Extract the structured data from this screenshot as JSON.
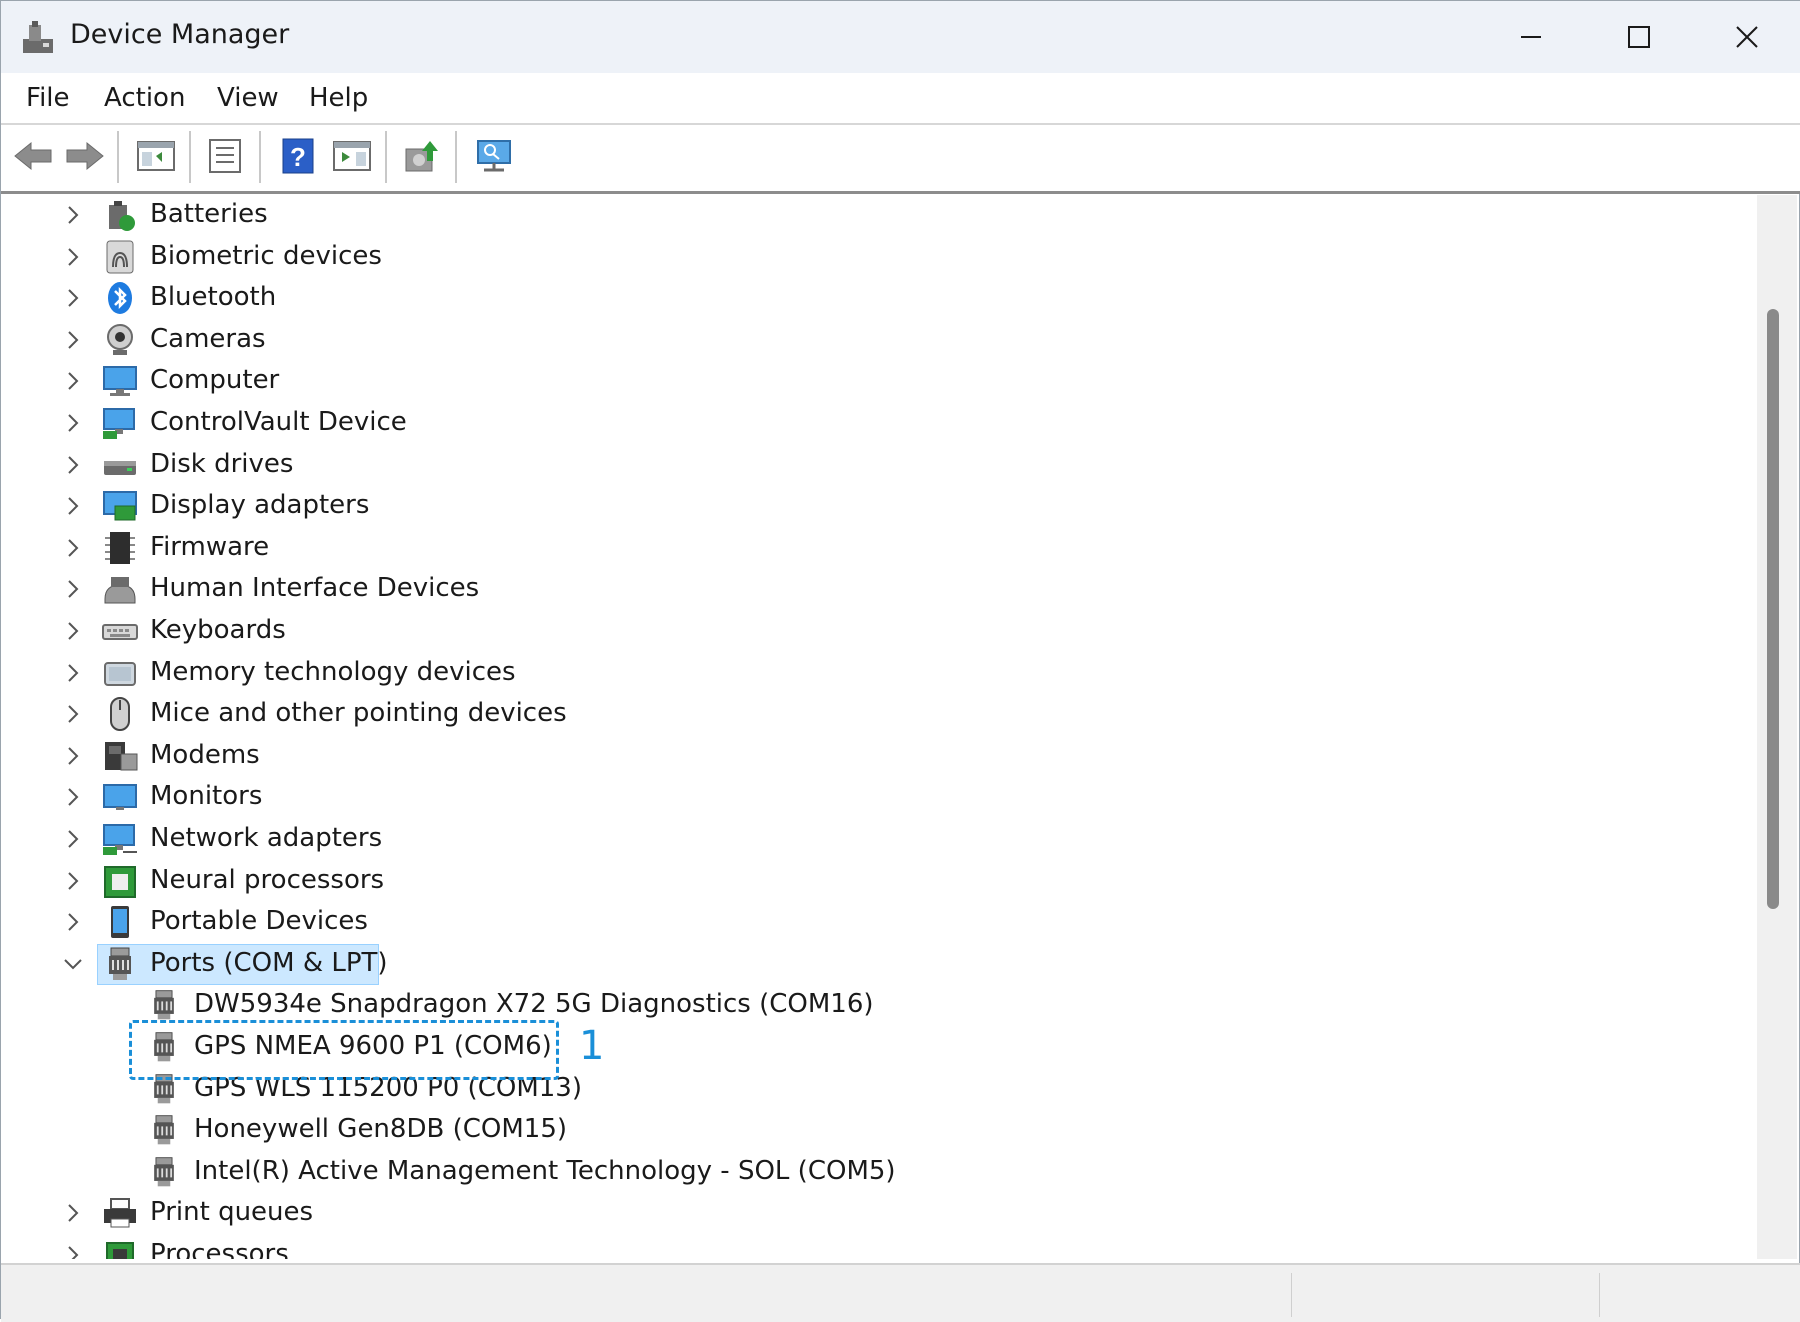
{
  "window": {
    "title": "Device Manager"
  },
  "menu": [
    "File",
    "Action",
    "View",
    "Help"
  ],
  "toolbar": [
    "back-icon",
    "forward-icon",
    "show-hide-console-tree-icon",
    "properties-icon",
    "help-icon",
    "action-pane-icon",
    "update-driver-icon",
    "scan-hardware-changes-icon"
  ],
  "tree": {
    "categories_before": [
      {
        "label": "Batteries",
        "icon": "battery-icon"
      },
      {
        "label": "Biometric devices",
        "icon": "fingerprint-icon"
      },
      {
        "label": "Bluetooth",
        "icon": "bluetooth-icon"
      },
      {
        "label": "Cameras",
        "icon": "camera-icon"
      },
      {
        "label": "Computer",
        "icon": "computer-icon"
      },
      {
        "label": "ControlVault Device",
        "icon": "controlvault-icon"
      },
      {
        "label": "Disk drives",
        "icon": "disk-drive-icon"
      },
      {
        "label": "Display adapters",
        "icon": "display-adapter-icon"
      },
      {
        "label": "Firmware",
        "icon": "firmware-icon"
      },
      {
        "label": "Human Interface Devices",
        "icon": "hid-icon"
      },
      {
        "label": "Keyboards",
        "icon": "keyboard-icon"
      },
      {
        "label": "Memory technology devices",
        "icon": "memory-icon"
      },
      {
        "label": "Mice and other pointing devices",
        "icon": "mouse-icon"
      },
      {
        "label": "Modems",
        "icon": "modem-icon"
      },
      {
        "label": "Monitors",
        "icon": "monitor-icon"
      },
      {
        "label": "Network adapters",
        "icon": "network-adapter-icon"
      },
      {
        "label": "Neural processors",
        "icon": "neural-processor-icon"
      },
      {
        "label": "Portable Devices",
        "icon": "portable-device-icon"
      }
    ],
    "expanded": {
      "label": "Ports (COM & LPT)",
      "icon": "port-icon",
      "children": [
        "DW5934e Snapdragon X72 5G Diagnostics (COM16)",
        "GPS NMEA 9600 P1 (COM6)",
        "GPS WLS 115200 P0 (COM13)",
        "Honeywell Gen8DB (COM15)",
        "Intel(R) Active Management Technology - SOL (COM5)"
      ]
    },
    "categories_after": [
      {
        "label": "Print queues",
        "icon": "printer-icon"
      },
      {
        "label": "Processors",
        "icon": "processor-icon"
      }
    ]
  },
  "callout": {
    "number": "1"
  },
  "colors": {
    "selection": "#cce8ff",
    "callout": "#1a8fd8"
  }
}
